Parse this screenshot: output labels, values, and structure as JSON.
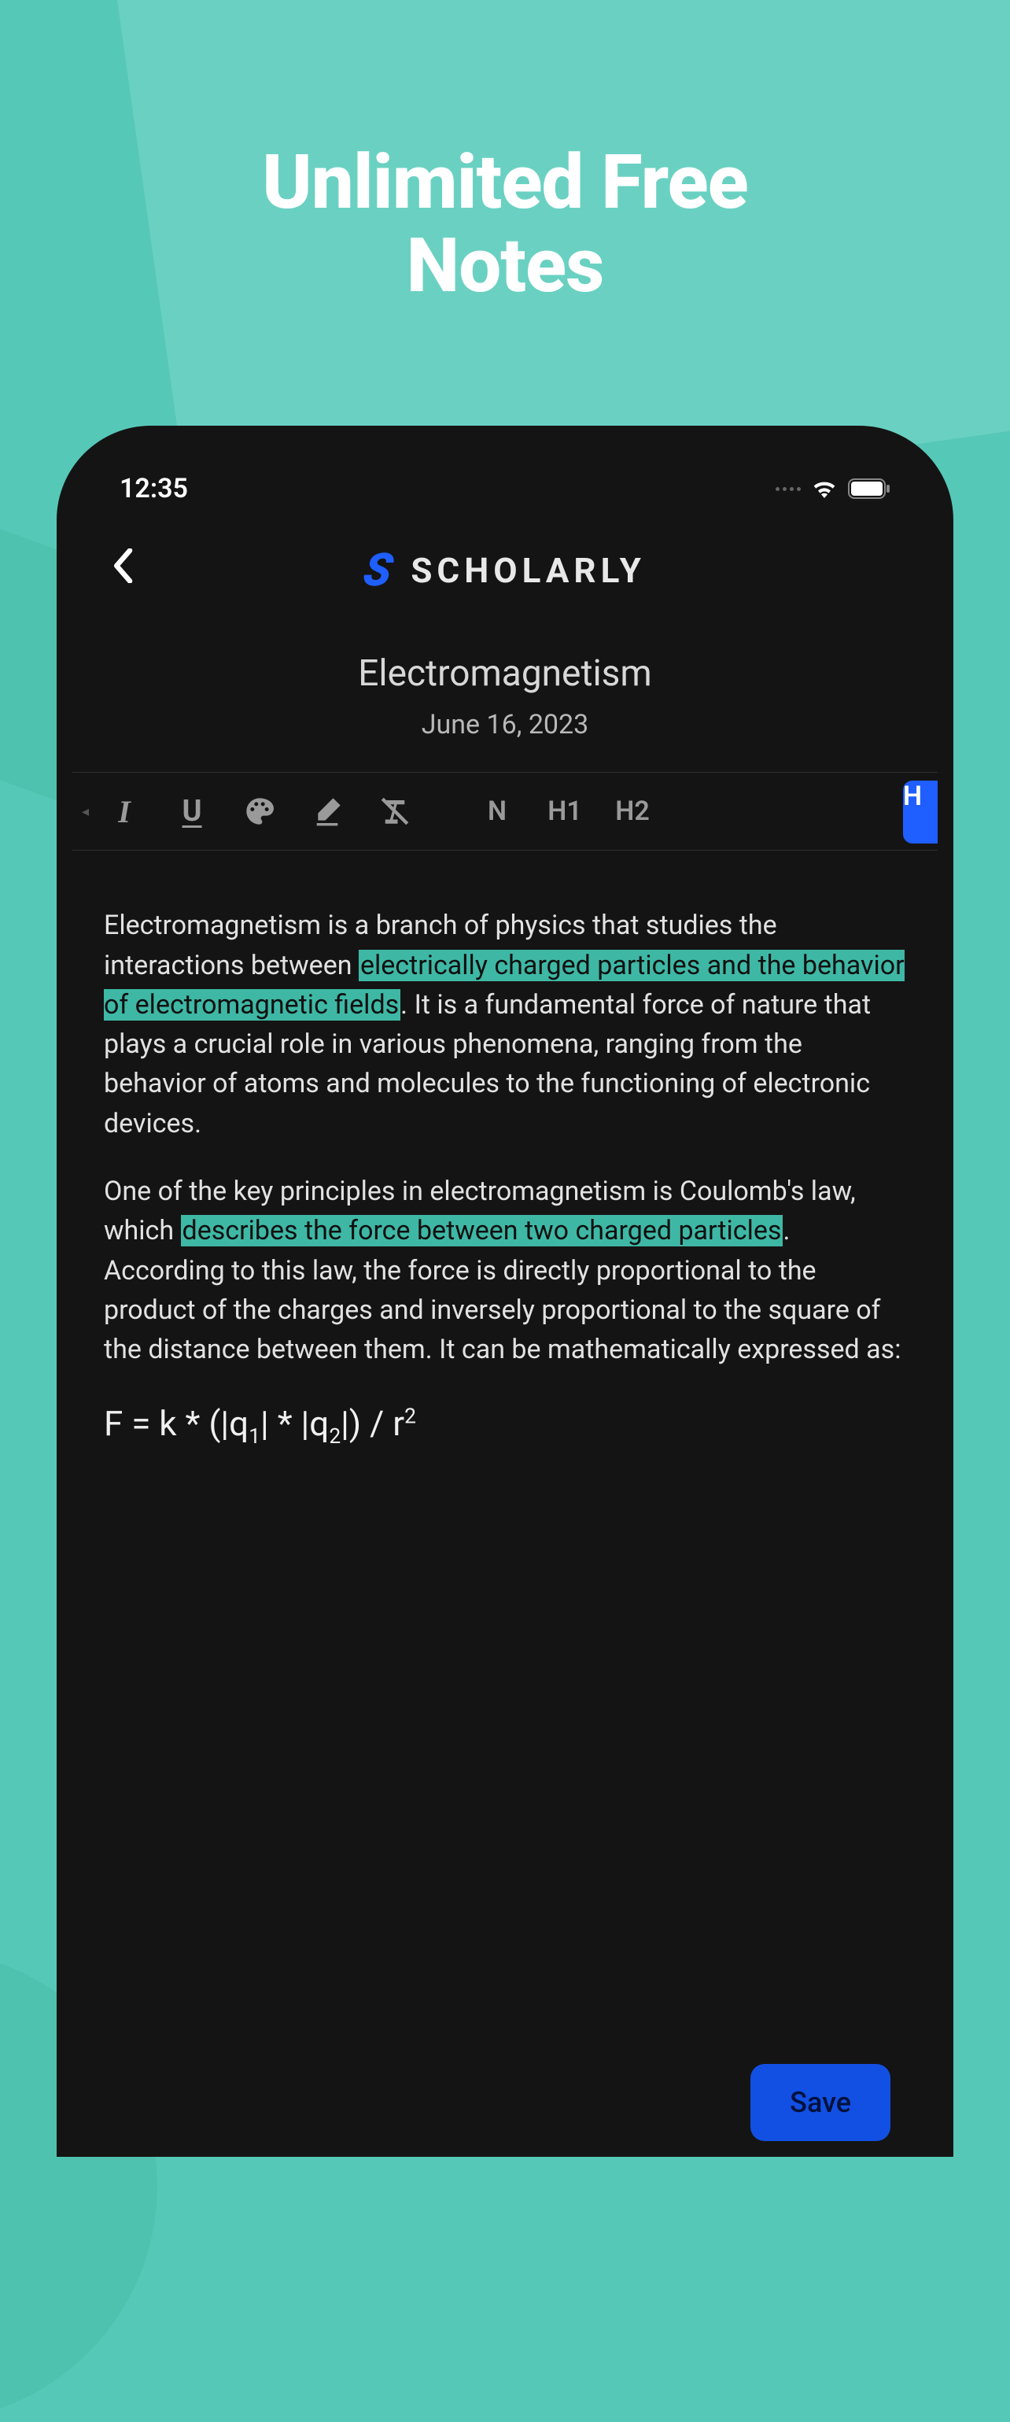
{
  "marketing": {
    "headline_line1": "Unlimited Free",
    "headline_line2": "Notes"
  },
  "status_bar": {
    "time": "12:35"
  },
  "header": {
    "back_icon": "chevron-left",
    "logo_letter": "S",
    "app_name": "SCHOLARLY"
  },
  "note": {
    "title": "Electromagnetism",
    "date": "June 16, 2023"
  },
  "toolbar": {
    "items": [
      {
        "id": "italic",
        "label": "I"
      },
      {
        "id": "underline",
        "label": "U"
      },
      {
        "id": "color",
        "label": "palette"
      },
      {
        "id": "highlight",
        "label": "fill"
      },
      {
        "id": "clear-format",
        "label": "clear-T"
      },
      {
        "id": "normal",
        "label": "N"
      },
      {
        "id": "heading1",
        "label": "H1"
      },
      {
        "id": "heading2",
        "label": "H2"
      },
      {
        "id": "heading3",
        "label": "H"
      }
    ]
  },
  "content": {
    "p1_a": "Electromagnetism is a branch of physics that studies the interactions between ",
    "p1_hl1": "electrically charged particles and the behavior of electromagnetic fields",
    "p1_b": ". It is a fundamental force of nature that plays a crucial role in various phenomena, ranging from the behavior of atoms and molecules to the functioning of electronic devices.",
    "p2_a": "One of the key principles in electromagnetism is Coulomb's law, which ",
    "p2_hl1": "describes the force between two charged particles",
    "p2_b": ". According to this law, the force is directly proportional to the product of the charges and inversely proportional to the square of the distance between them. It can be mathematically expressed as:",
    "formula": "F = k * (|q₁| * |q₂|) / r²"
  },
  "actions": {
    "save_label": "Save"
  },
  "colors": {
    "background": "#56c8b7",
    "phone_bg": "#141414",
    "accent_blue": "#1f5eff",
    "highlight": "#3eb8a5"
  }
}
